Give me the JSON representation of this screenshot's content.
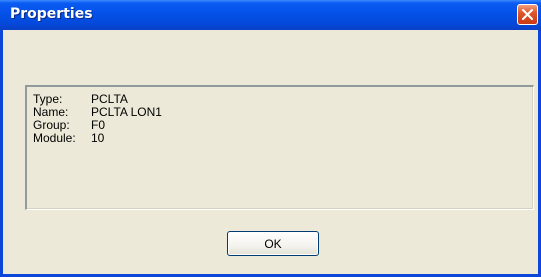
{
  "window": {
    "title": "Properties"
  },
  "properties": [
    {
      "label": "Type:",
      "value": "PCLTA"
    },
    {
      "label": "Name:",
      "value": "PCLTA LON1"
    },
    {
      "label": "Group:",
      "value": "F0"
    },
    {
      "label": "Module:",
      "value": "10"
    }
  ],
  "buttons": {
    "ok_label": "OK"
  },
  "colors": {
    "titlebar": "#0451e8",
    "frame": "#0a47d8",
    "face": "#ece9d8",
    "close": "#e0562c"
  },
  "icons": {
    "close": "close-icon"
  }
}
